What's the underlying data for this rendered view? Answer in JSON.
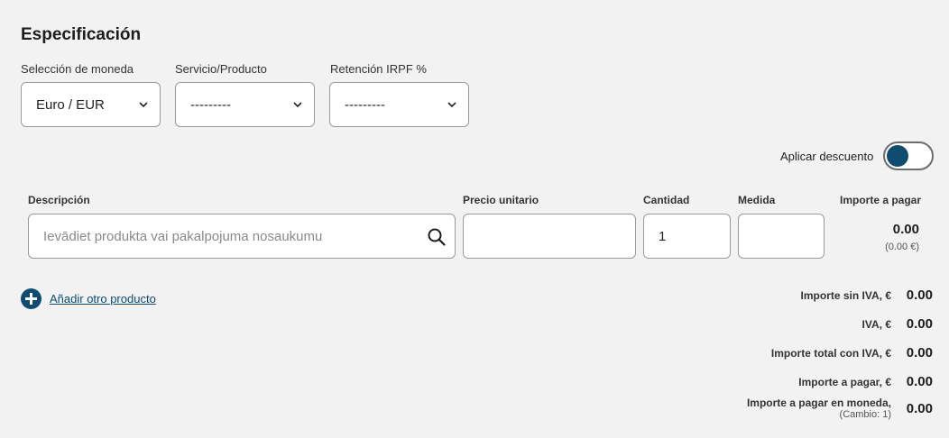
{
  "section": {
    "title": "Especificación"
  },
  "selects": {
    "currency": {
      "label": "Selección de moneda",
      "value": "Euro / EUR"
    },
    "product": {
      "label": "Servicio/Producto",
      "value": "---------"
    },
    "irpf": {
      "label": "Retención IRPF %",
      "value": "---------"
    }
  },
  "discount": {
    "label": "Aplicar descuento",
    "enabled": true
  },
  "columns": {
    "description": "Descripción",
    "unit_price": "Precio unitario",
    "quantity": "Cantidad",
    "measure": "Medida",
    "amount": "Importe a pagar"
  },
  "line": {
    "description_placeholder": "Ievādiet produkta vai pakalpojuma nosaukumu",
    "unit_price": "",
    "quantity": "1",
    "measure": "",
    "amount": "0.00",
    "amount_eur": "(0.00 €)"
  },
  "add_product": {
    "label": "Añadir otro producto"
  },
  "summary": {
    "net": {
      "label": "Importe sin IVA, €",
      "value": "0.00"
    },
    "vat": {
      "label": "IVA, €",
      "value": "0.00"
    },
    "total": {
      "label": "Importe total con IVA, €",
      "value": "0.00"
    },
    "payable": {
      "label": "Importe a pagar, €",
      "value": "0.00"
    },
    "payable_currency": {
      "label": "Importe a pagar en moneda,",
      "note": "(Cambio: 1)",
      "value": "0.00"
    }
  },
  "colors": {
    "accent": "#0f4c70",
    "background": "#f2f2f2"
  },
  "icons": {
    "search": "search-icon",
    "chevron": "chevron-down-icon",
    "add": "plus-circle-icon"
  }
}
